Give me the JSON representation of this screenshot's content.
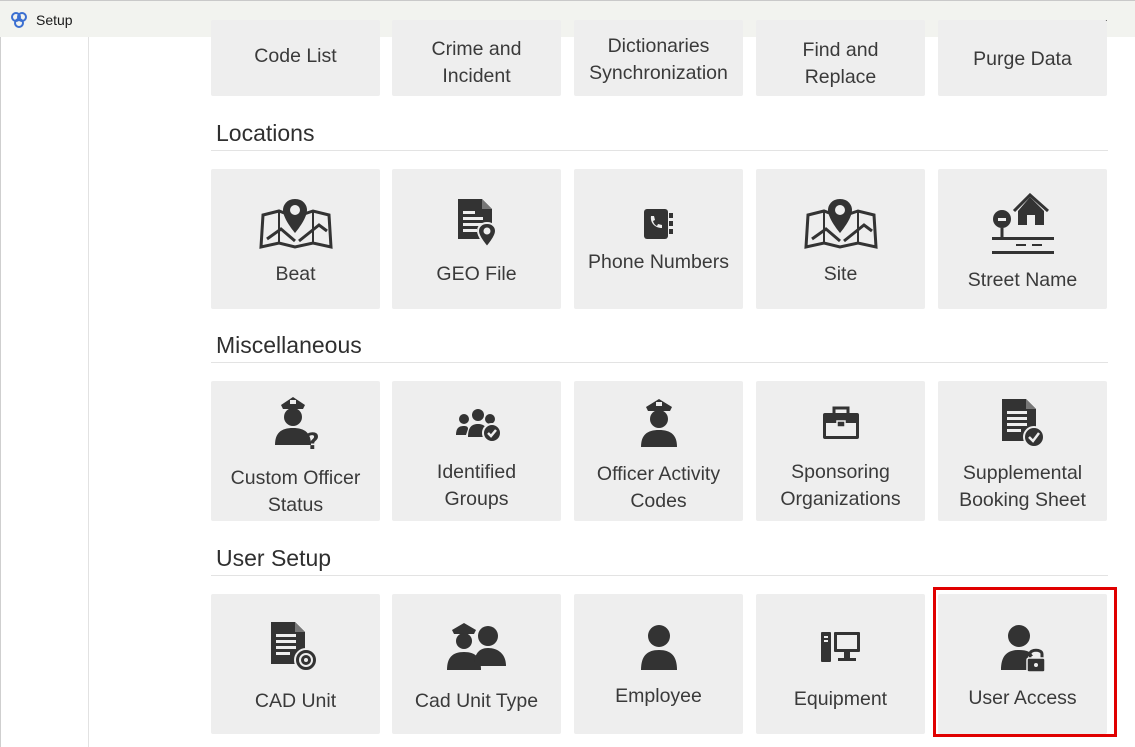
{
  "window": {
    "title": "Setup"
  },
  "top_tiles": [
    "Code List",
    "Crime and\nIncident",
    "Dictionaries\nSynchronization",
    "Find and\nReplace",
    "Purge Data"
  ],
  "sections": {
    "locations": {
      "title": "Locations",
      "tiles": [
        {
          "label": "Beat",
          "icon": "map-pin-icon"
        },
        {
          "label": "GEO File",
          "icon": "geo-file-icon"
        },
        {
          "label": "Phone Numbers",
          "icon": "address-book-icon"
        },
        {
          "label": "Site",
          "icon": "map-pin-icon"
        },
        {
          "label": "Street Name",
          "icon": "street-icon"
        }
      ]
    },
    "misc": {
      "title": "Miscellaneous",
      "tiles": [
        {
          "label": "Custom Officer\nStatus",
          "icon": "officer-question-icon"
        },
        {
          "label": "Identified\nGroups",
          "icon": "group-check-icon"
        },
        {
          "label": "Officer Activity\nCodes",
          "icon": "officer-icon"
        },
        {
          "label": "Sponsoring\nOrganizations",
          "icon": "briefcase-icon"
        },
        {
          "label": "Supplemental\nBooking Sheet",
          "icon": "document-check-icon"
        }
      ]
    },
    "user_setup": {
      "title": "User Setup",
      "tiles": [
        {
          "label": "CAD Unit",
          "icon": "document-gear-icon"
        },
        {
          "label": "Cad Unit Type",
          "icon": "officer-user-icon"
        },
        {
          "label": "Employee",
          "icon": "user-icon"
        },
        {
          "label": "Equipment",
          "icon": "computer-icon"
        },
        {
          "label": "User Access",
          "icon": "user-lock-icon"
        }
      ]
    }
  },
  "colors": {
    "tile_bg": "#eeeeee",
    "icon": "#333333",
    "highlight": "#e00000"
  }
}
